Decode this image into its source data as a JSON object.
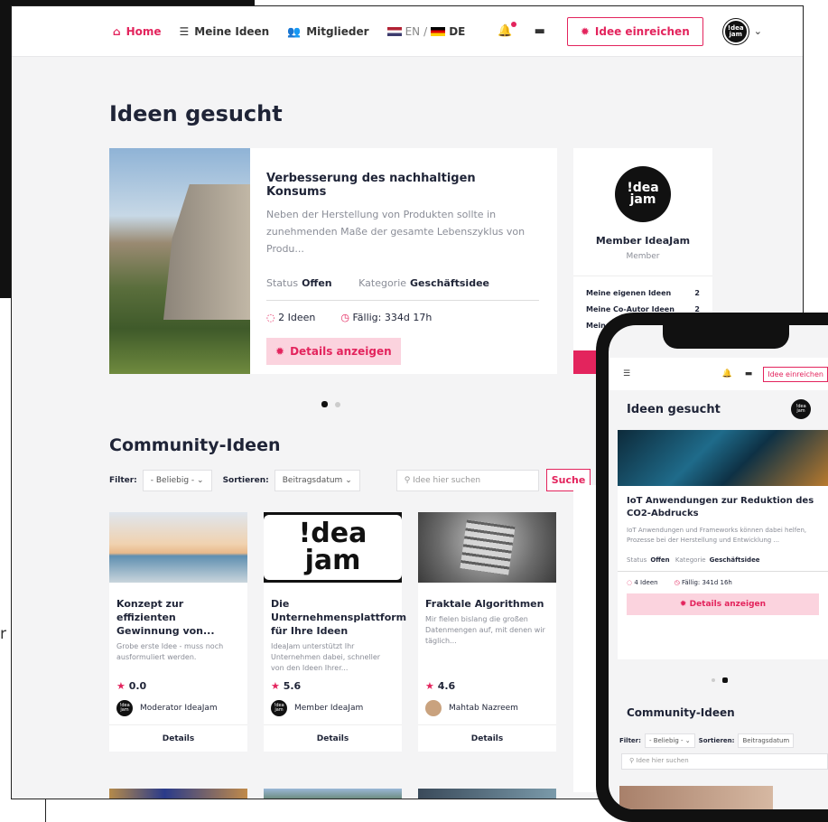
{
  "nav": {
    "home": "Home",
    "my_ideas": "Meine Ideen",
    "members": "Mitglieder",
    "lang_en": "EN",
    "lang_sep": "/",
    "lang_de": "DE",
    "submit": "Idee einreichen"
  },
  "hero": {
    "section_title": "Ideen gesucht",
    "title": "Verbesserung des nachhaltigen Konsums",
    "description": "Neben der Herstellung von Produkten sollte in zunehmenden Maße der gesamte Lebenszyklus von Produ...",
    "status_label": "Status",
    "status_value": "Offen",
    "category_label": "Kategorie",
    "category_value": "Geschäftsidee",
    "ideas_count": "2 Ideen",
    "due": "Fällig: 334d 17h",
    "details": "Details anzeigen"
  },
  "profile": {
    "avatar_text": "!dea jam",
    "name": "Member IdeaJam",
    "role": "Member",
    "rows": [
      {
        "label": "Meine eigenen Ideen",
        "value": "2"
      },
      {
        "label": "Meine Co-Autor Ideen",
        "value": "2"
      },
      {
        "label": "Meine",
        "value": ""
      }
    ]
  },
  "community": {
    "title": "Community-Ideen",
    "filter_label": "Filter:",
    "filter_value": "- Beliebig -",
    "sort_label": "Sortieren:",
    "sort_value": "Beitragsdatum",
    "search_placeholder": "Idee hier suchen",
    "search_button": "Suche",
    "cards": [
      {
        "title": "Konzept zur effizienten Gewinnung von...",
        "desc": "Grobe erste Idee - muss noch ausformuliert werden.",
        "rating": "0.0",
        "author": "Moderator IdeaJam",
        "action": "Details"
      },
      {
        "title": "Die Unternehmensplattform für Ihre Ideen",
        "desc": "IdeaJam unterstützt Ihr Unternehmen dabei, schneller von den Ideen Ihrer...",
        "rating": "5.6",
        "author": "Member IdeaJam",
        "action": "Details"
      },
      {
        "title": "Fraktale Algorithmen",
        "desc": "Mir fielen bislang die großen Datenmengen auf, mit denen wir täglich...",
        "rating": "4.6",
        "author": "Mahtab Nazreem",
        "action": "Details"
      }
    ]
  },
  "mobile": {
    "submit": "Idee einreichen",
    "section_title": "Ideen gesucht",
    "card_title": "IoT Anwendungen zur Reduktion des CO2-Abdrucks",
    "card_desc": "IoT Anwendungen und Frameworks können dabei helfen, Prozesse bei der Herstellung und Entwicklung ...",
    "status_label": "Status",
    "status_value": "Offen",
    "category_label": "Kategorie",
    "category_value": "Geschäftsidee",
    "ideas": "4 Ideen",
    "due": "Fällig: 341d 16h",
    "details": "Details anzeigen",
    "community_title": "Community-Ideen",
    "filter_label": "Filter:",
    "filter_value": "- Beliebig -",
    "sort_label": "Sortieren:",
    "sort_value": "Beitragsdatum",
    "search_placeholder": "Idee hier suchen"
  },
  "side_fragment": "r"
}
